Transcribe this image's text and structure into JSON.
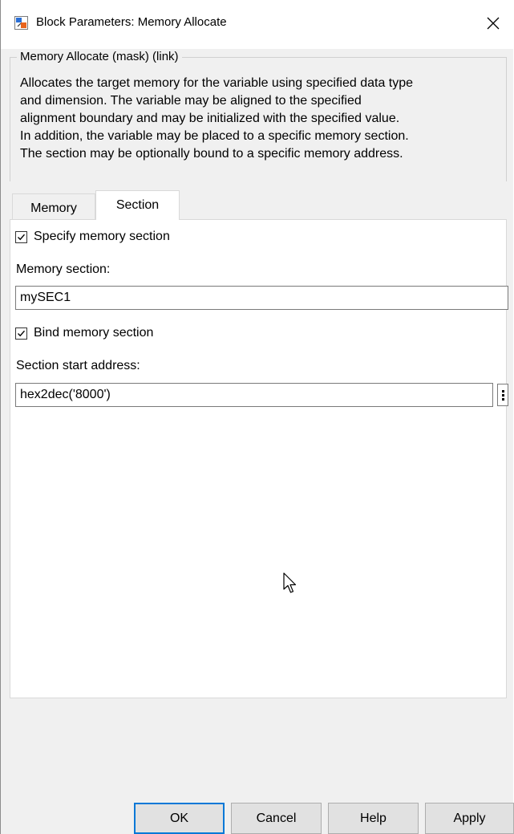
{
  "window": {
    "title": "Block Parameters: Memory Allocate",
    "close_glyph": "×"
  },
  "mask": {
    "header": "Memory Allocate (mask) (link)",
    "description": "Allocates the target memory for the variable using specified data type\nand dimension. The variable may be aligned to the specified\nalignment boundary and may be initialized with the specified value.\nIn addition, the variable may be placed to a specific memory section.\nThe section may be optionally bound to a specific memory address."
  },
  "tabs": [
    {
      "label": "Memory",
      "active": false
    },
    {
      "label": "Section",
      "active": true
    }
  ],
  "section_tab": {
    "specify_checkbox": {
      "label": "Specify memory section",
      "checked": true
    },
    "memory_section": {
      "label": "Memory section:",
      "value": "mySEC1"
    },
    "bind_checkbox": {
      "label": "Bind memory section",
      "checked": true
    },
    "start_address": {
      "label": "Section start address:",
      "value": "hex2dec('8000')"
    }
  },
  "buttons": {
    "ok": "OK",
    "cancel": "Cancel",
    "help": "Help",
    "apply": "Apply"
  },
  "icons": {
    "app": "simulink-block-icon",
    "close": "close-icon",
    "more": "vertical-ellipsis-icon",
    "cursor": "mouse-pointer-icon"
  },
  "colors": {
    "accent": "#0078d7",
    "dialog_bg": "#f0f0f0",
    "panel_bg": "#ffffff"
  }
}
